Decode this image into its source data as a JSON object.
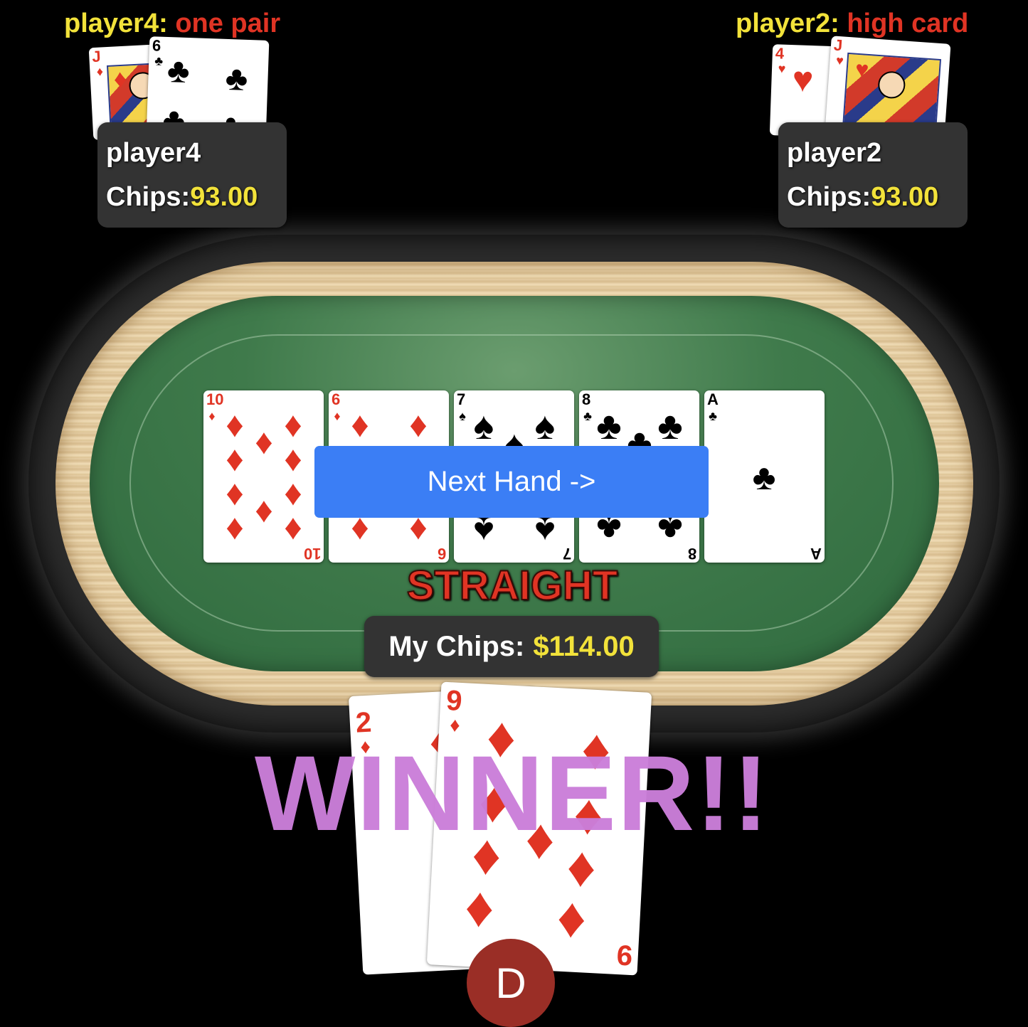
{
  "players": [
    {
      "name": "player4",
      "hand_label": "player4:",
      "hand_result": "one pair",
      "chips_label": "Chips:",
      "chips_value": "93.00",
      "cards": [
        {
          "rank": "J",
          "suit": "♦"
        },
        {
          "rank": "6",
          "suit": "♣"
        }
      ]
    },
    {
      "name": "player2",
      "hand_label": "player2:",
      "hand_result": "high card",
      "chips_label": "Chips:",
      "chips_value": "93.00",
      "cards": [
        {
          "rank": "4",
          "suit": "♥"
        },
        {
          "rank": "J",
          "suit": "♥"
        }
      ]
    }
  ],
  "community_cards": [
    {
      "rank": "10",
      "suit": "♦"
    },
    {
      "rank": "6",
      "suit": "♦"
    },
    {
      "rank": "7",
      "suit": "♠"
    },
    {
      "rank": "8",
      "suit": "♣"
    },
    {
      "rank": "A",
      "suit": "♣"
    }
  ],
  "next_hand_button": "Next Hand ->",
  "my_hand_result": "STRAIGHT",
  "my_chips": {
    "label": "My Chips:",
    "value": "$114.00"
  },
  "my_cards": [
    {
      "rank": "2",
      "suit": "♦"
    },
    {
      "rank": "9",
      "suit": "♦"
    }
  ],
  "winner_text": "WINNER!!",
  "dealer_button": "D",
  "colors": {
    "button": "#3b7ef5",
    "winner": "#cb7ed9",
    "chips": "#f2e23a",
    "red_suit": "#e03424",
    "dealer": "#9a2e26"
  }
}
